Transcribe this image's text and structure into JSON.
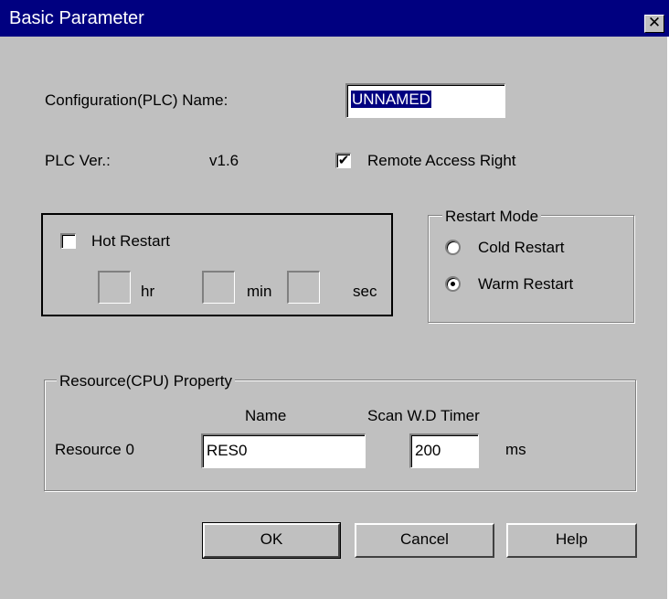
{
  "window": {
    "title": "Basic Parameter",
    "close_glyph": "✕"
  },
  "config": {
    "name_label": "Configuration(PLC) Name:",
    "name_value": "UNNAMED"
  },
  "plc": {
    "version_label": "PLC Ver.:",
    "version_value": "v1.6",
    "remote_access_label": "Remote Access Right",
    "remote_access_checked": true,
    "check_glyph": "✔"
  },
  "hot_restart": {
    "label": "Hot Restart",
    "checked": false,
    "hr_label": "hr",
    "min_label": "min",
    "sec_label": "sec"
  },
  "restart_mode": {
    "legend": "Restart Mode",
    "options": [
      {
        "label": "Cold Restart",
        "selected": false
      },
      {
        "label": "Warm Restart",
        "selected": true
      }
    ]
  },
  "resource": {
    "legend": "Resource(CPU) Property",
    "name_header": "Name",
    "timer_header": "Scan W.D Timer",
    "row_label": "Resource 0",
    "name_value": "RES0",
    "timer_value": "200",
    "unit": "ms"
  },
  "buttons": {
    "ok": "OK",
    "cancel": "Cancel",
    "help": "Help"
  },
  "colors": {
    "titlebar": "#000080",
    "face": "#c0c0c0",
    "selection": "#000080"
  }
}
